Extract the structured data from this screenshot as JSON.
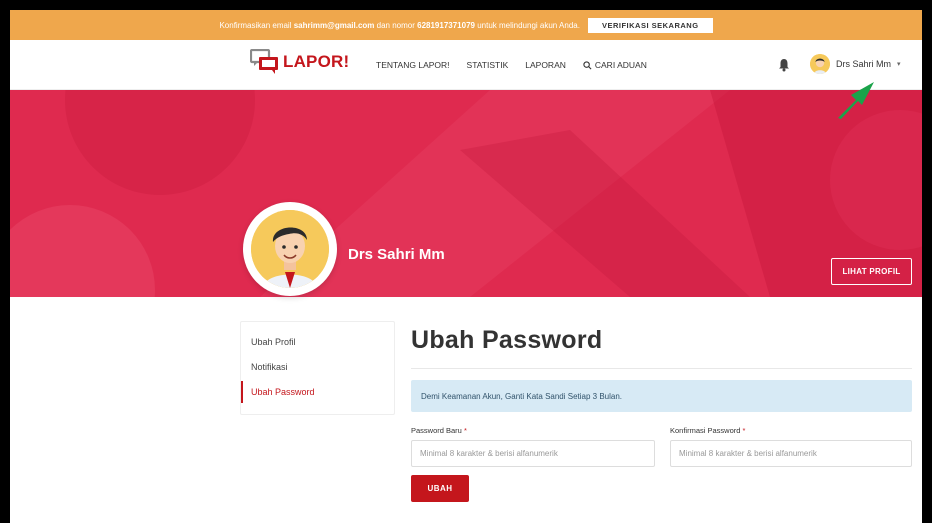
{
  "notice": {
    "text_1": "Konfirmasikan email ",
    "email": "sahrimm@gmail.com",
    "text_2": " dan nomor ",
    "phone": "6281917371079",
    "text_3": " untuk melindungi akun Anda.",
    "verify_label": "VERIFIKASI SEKARANG"
  },
  "nav": {
    "logo": "LAPOR!",
    "links": [
      "TENTANG LAPOR!",
      "STATISTIK",
      "LAPORAN",
      "CARI ADUAN"
    ],
    "user_name": "Drs Sahri Mm",
    "caret": "▾"
  },
  "profile": {
    "name": "Drs Sahri Mm",
    "view_profile_label": "LIHAT PROFIL"
  },
  "sidebar": {
    "items": [
      "Ubah Profil",
      "Notifikasi",
      "Ubah Password"
    ],
    "active_index": 2
  },
  "main": {
    "title": "Ubah Password",
    "alert": "Demi Keamanan Akun, Ganti Kata Sandi Setiap 3 Bulan.",
    "new_password_label": "Password Baru",
    "new_password_placeholder": "Minimal 8 karakter & berisi alfanumerik",
    "confirm_password_label": "Konfirmasi Password",
    "confirm_password_placeholder": "Minimal 8 karakter & berisi alfanumerik",
    "required_mark": "*",
    "submit_label": "UBAH"
  },
  "colors": {
    "brand": "#c4161c",
    "notice": "#efa74c",
    "banner": "#e0294e",
    "alert_bg": "#d7eaf5",
    "arrow": "#1aa34a"
  },
  "icons": [
    "lapor-logo-icon",
    "search-icon",
    "bell-icon",
    "user-avatar-icon",
    "annotation-arrow-icon"
  ]
}
